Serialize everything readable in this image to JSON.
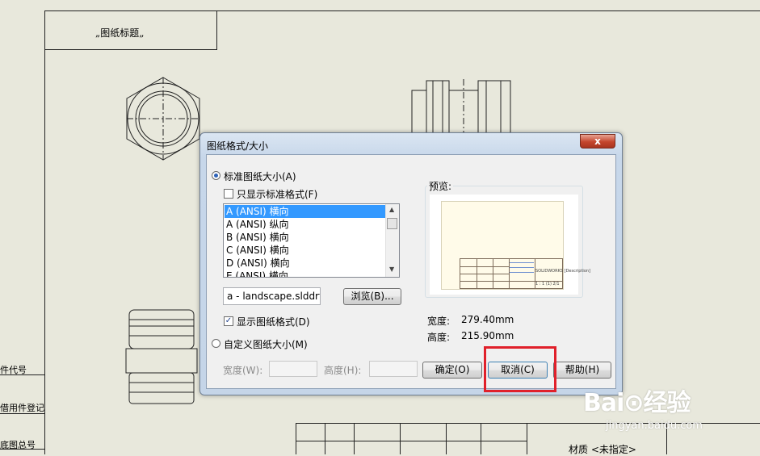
{
  "drawing": {
    "title_block_text": "„图纸标题„",
    "side_labels": [
      "件代号",
      "借用件登记",
      "底图总号"
    ],
    "material_label": "材质 <未指定>"
  },
  "dialog": {
    "title": "图纸格式/大小",
    "close_symbol": "x",
    "standard_size_label": "标准图纸大小(A)",
    "only_standard_formats_label": "只显示标准格式(F)",
    "size_list": [
      {
        "label": "A (ANSI) 横向",
        "selected": true
      },
      {
        "label": "A (ANSI) 纵向",
        "selected": false
      },
      {
        "label": "B (ANSI) 横向",
        "selected": false
      },
      {
        "label": "C (ANSI) 横向",
        "selected": false
      },
      {
        "label": "D (ANSI) 横向",
        "selected": false
      },
      {
        "label": "E (ANSI) 横向",
        "selected": false
      }
    ],
    "format_file_value": "a - landscape.slddrt",
    "browse_label": "浏览(B)...",
    "show_format_label": "显示图纸格式(D)",
    "show_format_checked": true,
    "custom_size_label": "自定义图纸大小(M)",
    "custom_width_label": "宽度(W):",
    "custom_height_label": "高度(H):",
    "preview_label": "预览:",
    "preview_desc_text": "SOLIDWORKS [Description]",
    "preview_scale_text": "1 : 1  (1) 2/1",
    "width_label": "宽度:",
    "width_value": "279.40mm",
    "height_label": "高度:",
    "height_value": "215.90mm",
    "ok_label": "确定(O)",
    "cancel_label": "取消(C)",
    "help_label": "帮助(H)"
  },
  "watermark": {
    "main": "Bai⊙经验",
    "sub": "jingyan.baidu.com"
  },
  "colors": {
    "background": "#e8e8dc",
    "selection": "#3399ff",
    "highlight": "#e0202a"
  }
}
